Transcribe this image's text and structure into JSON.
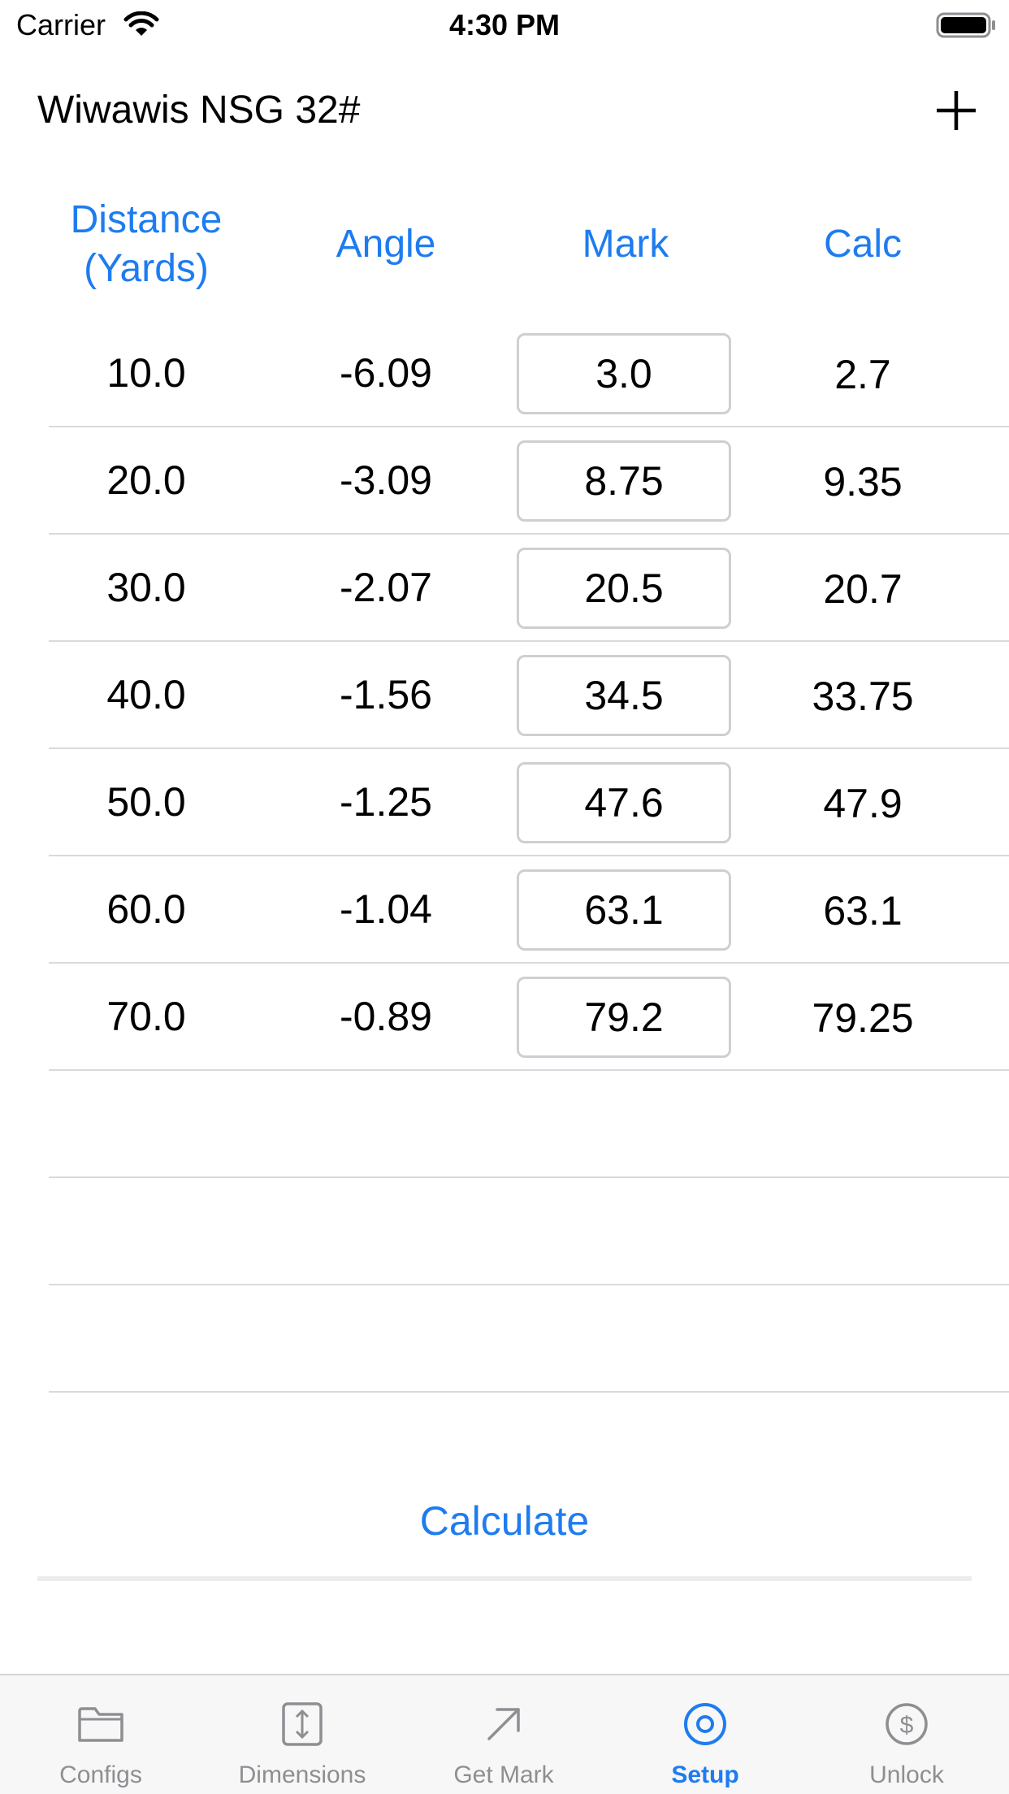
{
  "status_bar": {
    "carrier": "Carrier",
    "time": "4:30 PM"
  },
  "header": {
    "title": "Wiwawis NSG 32#",
    "add_icon": "plus-icon"
  },
  "table": {
    "columns": {
      "distance_line1": "Distance",
      "distance_line2": "(Yards)",
      "angle": "Angle",
      "mark": "Mark",
      "calc": "Calc"
    },
    "rows": [
      {
        "distance": "10.0",
        "angle": "-6.09",
        "mark": "3.0",
        "calc": "2.7"
      },
      {
        "distance": "20.0",
        "angle": "-3.09",
        "mark": "8.75",
        "calc": "9.35"
      },
      {
        "distance": "30.0",
        "angle": "-2.07",
        "mark": "20.5",
        "calc": "20.7"
      },
      {
        "distance": "40.0",
        "angle": "-1.56",
        "mark": "34.5",
        "calc": "33.75"
      },
      {
        "distance": "50.0",
        "angle": "-1.25",
        "mark": "47.6",
        "calc": "47.9"
      },
      {
        "distance": "60.0",
        "angle": "-1.04",
        "mark": "63.1",
        "calc": "63.1"
      },
      {
        "distance": "70.0",
        "angle": "-0.89",
        "mark": "79.2",
        "calc": "79.25"
      }
    ],
    "empty_rows": 3
  },
  "actions": {
    "calculate_label": "Calculate"
  },
  "tab_bar": {
    "active": "Setup",
    "tabs": [
      {
        "label": "Configs",
        "icon": "folder-icon"
      },
      {
        "label": "Dimensions",
        "icon": "resize-vertical-icon"
      },
      {
        "label": "Get Mark",
        "icon": "arrow-up-right-icon"
      },
      {
        "label": "Setup",
        "icon": "target-icon"
      },
      {
        "label": "Unlock",
        "icon": "dollar-icon"
      }
    ]
  },
  "colors": {
    "accent": "#1e7cf0",
    "inactive_tab": "#8e8e93",
    "separator": "#d9d9de"
  }
}
